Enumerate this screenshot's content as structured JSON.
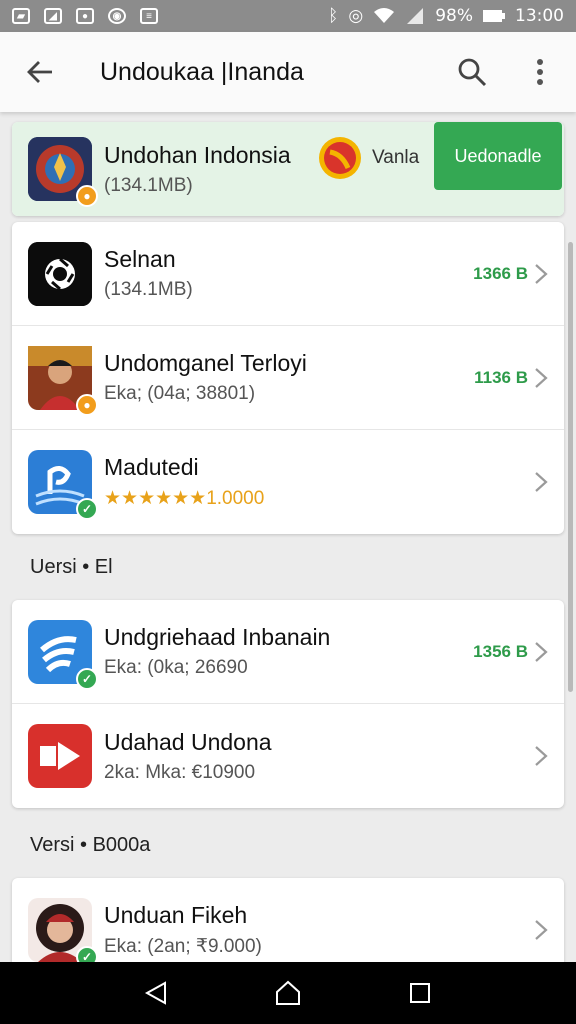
{
  "status_bar": {
    "battery": "98%",
    "time": "13:00"
  },
  "app_bar": {
    "title": "Undoukaa |Inanda"
  },
  "featured": {
    "name": "Undohan Indonsia",
    "sub": "(134.1MB)",
    "label": "Vanla",
    "button_label": "Uedonadle"
  },
  "group1": [
    {
      "name": "Selnan",
      "sub": "(134.1MB)",
      "size": "1366 B",
      "icon": "camera-shutter-icon"
    },
    {
      "name": "Undomganel Terloyi",
      "sub": "Eka; (04a; 38801)",
      "size": "1136 B",
      "icon": "person-photo-icon"
    },
    {
      "name": "Madutedi",
      "sub": "★★★★★★1.0000",
      "size": "",
      "icon": "wave-app-icon"
    }
  ],
  "section2": {
    "label": "Uersi • El"
  },
  "group2": [
    {
      "name": "Undgriehaad Inbanain",
      "sub": "Eka: (0ka; 26690",
      "size": "1356 B",
      "icon": "wifi-app-icon"
    },
    {
      "name": "Udahad Undona",
      "sub": "2ka: Mka: €10900",
      "size": "",
      "icon": "video-app-icon"
    }
  ],
  "section3": {
    "label": "Versi • B000a"
  },
  "group3": [
    {
      "name": "Unduan Fikeh",
      "sub": "Eka: (2an; ₹9.000)",
      "size": "",
      "icon": "person-photo-icon"
    }
  ],
  "colors": {
    "accent": "#34a853",
    "featured_bg": "#e4f3e6",
    "rating": "#e8a21a"
  }
}
